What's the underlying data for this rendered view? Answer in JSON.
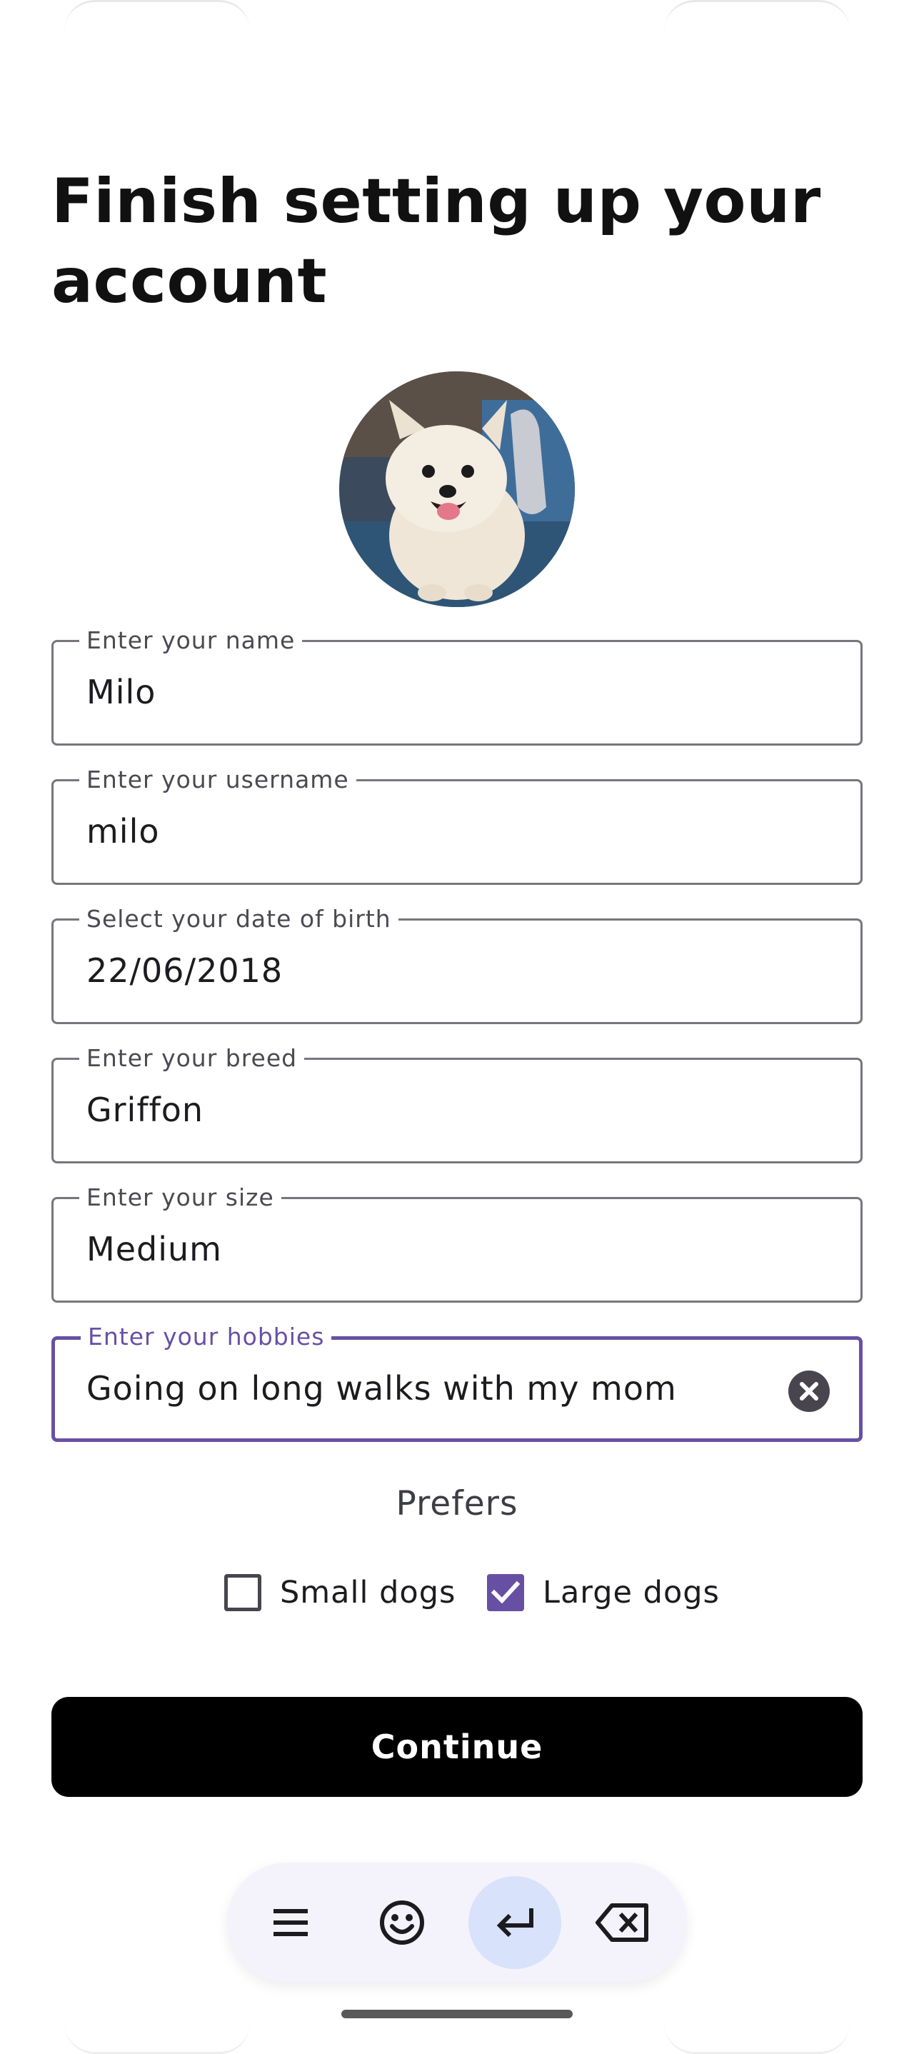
{
  "page": {
    "title": "Finish setting up your account"
  },
  "form": {
    "fields": [
      {
        "label": "Enter your name",
        "value": "Milo"
      },
      {
        "label": "Enter your username",
        "value": "milo"
      },
      {
        "label": "Select your date of birth",
        "value": "22/06/2018"
      },
      {
        "label": "Enter your breed",
        "value": "Griffon"
      },
      {
        "label": "Enter your size",
        "value": "Medium"
      },
      {
        "label": "Enter your hobbies",
        "value": "Going on long walks with my mom"
      }
    ],
    "focused_field": "Enter your hobbies"
  },
  "preferences": {
    "heading": "Prefers",
    "options": [
      {
        "label": "Small dogs",
        "checked": false
      },
      {
        "label": "Large dogs",
        "checked": true
      }
    ]
  },
  "actions": {
    "continue_label": "Continue"
  },
  "keyboard_toolbar": {
    "buttons": [
      "menu-icon",
      "emoji-icon",
      "enter-icon",
      "backspace-icon"
    ],
    "active": "enter-icon"
  },
  "colors": {
    "accent": "#6750a4",
    "outline": "#79747e",
    "button": "#000000",
    "toolbar_bg": "#f4f3fb",
    "toolbar_active": "#d8e2fb"
  }
}
